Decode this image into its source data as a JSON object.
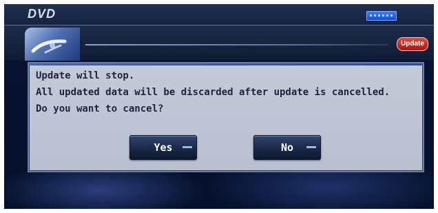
{
  "topbar": {
    "source": "DVD"
  },
  "header": {
    "badge": "Update"
  },
  "dialog": {
    "lines": [
      "Update will stop.",
      "All updated data will be discarded after update is cancelled.",
      "Do you want to cancel?"
    ],
    "buttons": {
      "yes": "Yes",
      "no": "No"
    }
  },
  "colors": {
    "dialog_bg": "#c5cad8",
    "button_bg": "#1a2747",
    "badge_red": "#c42a1e"
  },
  "icons": {
    "emblem": "disc-emblem-icon",
    "status": "status-indicator-icon"
  }
}
